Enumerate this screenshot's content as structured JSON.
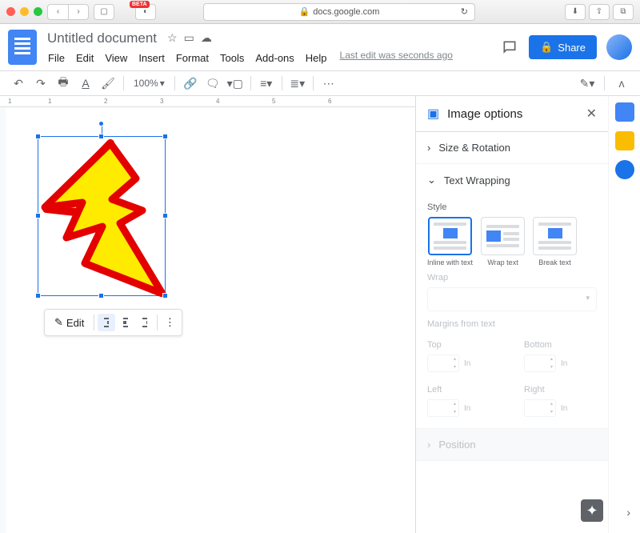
{
  "browser": {
    "url": "docs.google.com",
    "badge": "BETA"
  },
  "doc": {
    "title": "Untitled document",
    "last_edit": "Last edit was seconds ago",
    "menus": [
      "File",
      "Edit",
      "View",
      "Insert",
      "Format",
      "Tools",
      "Add-ons",
      "Help"
    ]
  },
  "share": {
    "label": "Share"
  },
  "toolbar": {
    "zoom": "100%"
  },
  "ruler": {
    "marks": [
      "1",
      "2",
      "1",
      "2",
      "3",
      "4",
      "5",
      "6"
    ]
  },
  "ctx": {
    "edit": "Edit"
  },
  "sidebar": {
    "title": "Image options",
    "size_rotation": "Size & Rotation",
    "text_wrapping": "Text Wrapping",
    "style_label": "Style",
    "wrap_opts": {
      "inline": "Inline with text",
      "wrap": "Wrap text",
      "break": "Break text"
    },
    "wrap_section": "Wrap",
    "margins_label": "Margins from text",
    "margins": {
      "top": "Top",
      "bottom": "Bottom",
      "left": "Left",
      "right": "Right",
      "unit": "In"
    },
    "position": "Position"
  }
}
